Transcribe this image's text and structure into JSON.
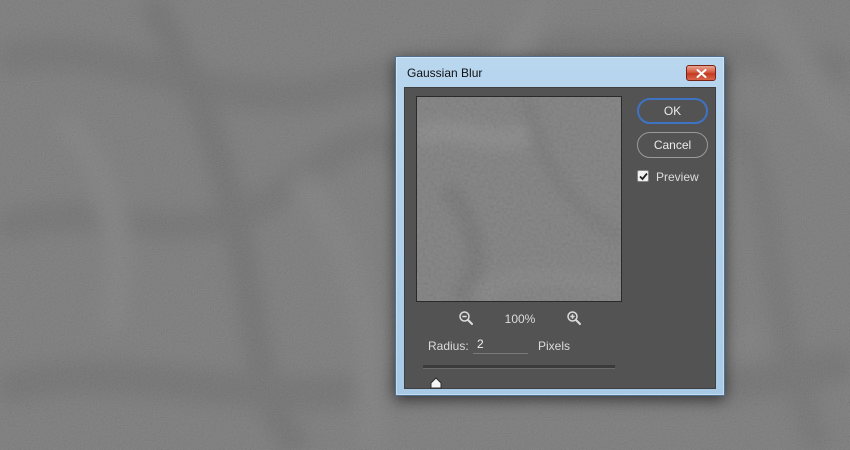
{
  "background": {
    "description_icon": "fur-texture-photo"
  },
  "dialog": {
    "title": "Gaussian Blur",
    "close_icon": "close-icon",
    "zoom": {
      "out_icon": "zoom-out-icon",
      "level": "100%",
      "in_icon": "zoom-in-icon"
    },
    "radius": {
      "label": "Radius:",
      "value": "2",
      "unit": "Pixels",
      "slider_fraction": 0.02
    },
    "buttons": {
      "ok": "OK",
      "cancel": "Cancel"
    },
    "preview_checkbox": {
      "label": "Preview",
      "checked": true
    }
  },
  "colors": {
    "panel": "#535353",
    "titlebar": "#b8d6ee",
    "ok_border": "#3e73c4",
    "close_button": "#c8462c"
  }
}
